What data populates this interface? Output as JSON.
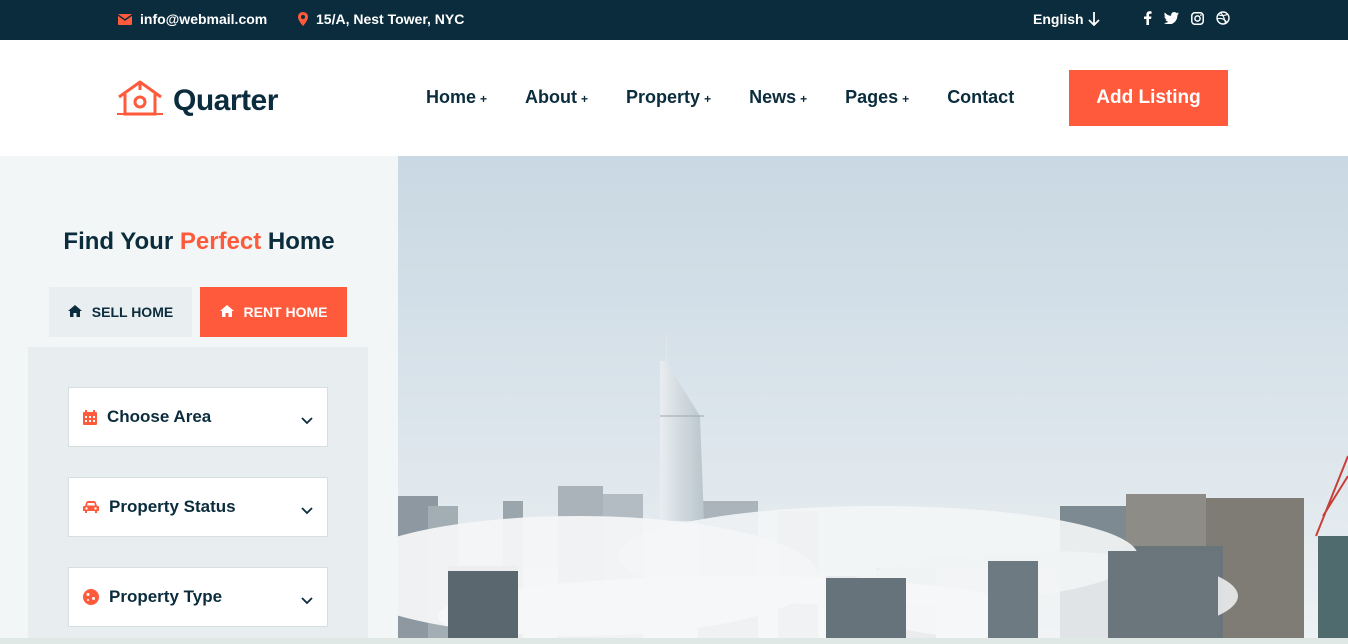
{
  "topbar": {
    "email": "info@webmail.com",
    "address": "15/A, Nest Tower, NYC",
    "language": "English",
    "social_icons": [
      "facebook-icon",
      "twitter-icon",
      "instagram-icon",
      "dribbble-icon"
    ]
  },
  "header": {
    "logo_text": "Quarter",
    "nav": [
      {
        "label": "Home",
        "plus": "+"
      },
      {
        "label": "About",
        "plus": "+"
      },
      {
        "label": "Property",
        "plus": "+"
      },
      {
        "label": "News",
        "plus": "+"
      },
      {
        "label": "Pages",
        "plus": "+"
      },
      {
        "label": "Contact",
        "plus": ""
      }
    ],
    "cta_label": "Add Listing"
  },
  "search": {
    "title_part1": "Find Your ",
    "title_accent": "Perfect",
    "title_part2": " Home",
    "tab_sell": "SELL HOME",
    "tab_rent": "RENT HOME",
    "fields": [
      {
        "label": "Choose Area",
        "icon": "calendar-icon"
      },
      {
        "label": "Property Status",
        "icon": "car-icon"
      },
      {
        "label": "Property Type",
        "icon": "cookie-icon"
      }
    ]
  },
  "colors": {
    "navy": "#0b2c3d",
    "accent": "#ff5a3c",
    "panel_bg": "#f2f6f7"
  }
}
